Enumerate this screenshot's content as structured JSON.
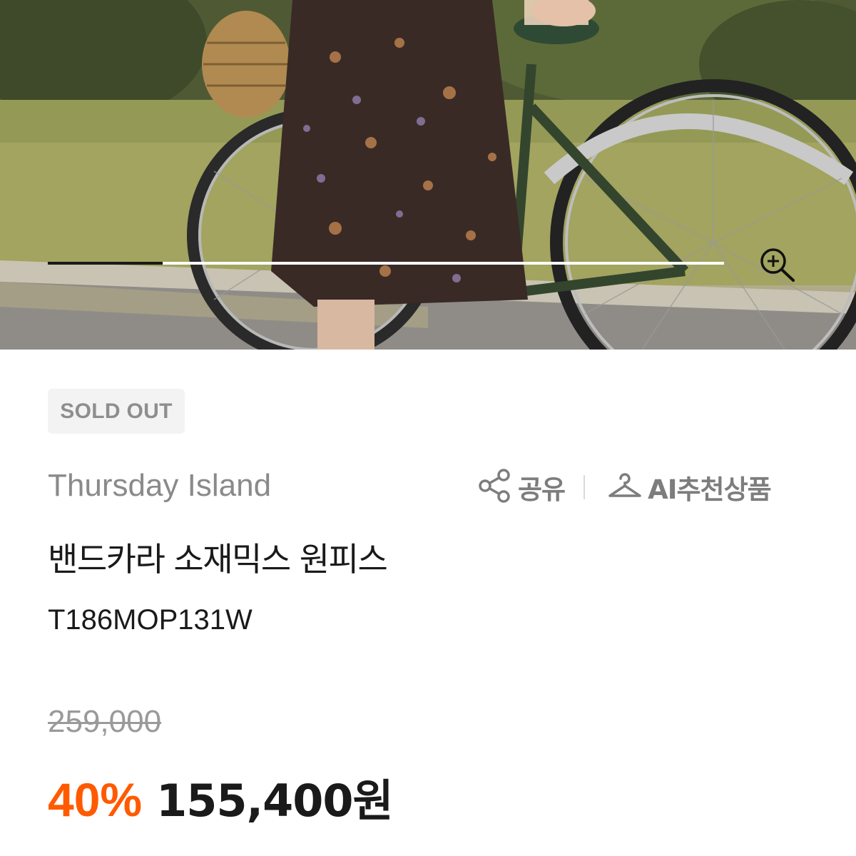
{
  "product_image": {
    "gallery_progress": 0.17
  },
  "icons": {
    "zoom": "zoom-in-icon",
    "share": "share-icon",
    "ai_recommend": "hanger-icon"
  },
  "badge": {
    "label": "SOLD OUT"
  },
  "brand": {
    "name": "Thursday Island"
  },
  "actions": {
    "share_label": "공유",
    "ai_label": "AI추천상품"
  },
  "product": {
    "title": "밴드카라 소재믹스 원피스",
    "code": "T186MOP131W"
  },
  "pricing": {
    "original_price": "259,000",
    "discount_rate": "40%",
    "sale_price": "155,400원"
  },
  "colors": {
    "accent": "#ff5a00",
    "text_primary": "#1a1a1a",
    "text_muted": "#8a8a8a",
    "badge_bg": "#f3f3f3"
  }
}
